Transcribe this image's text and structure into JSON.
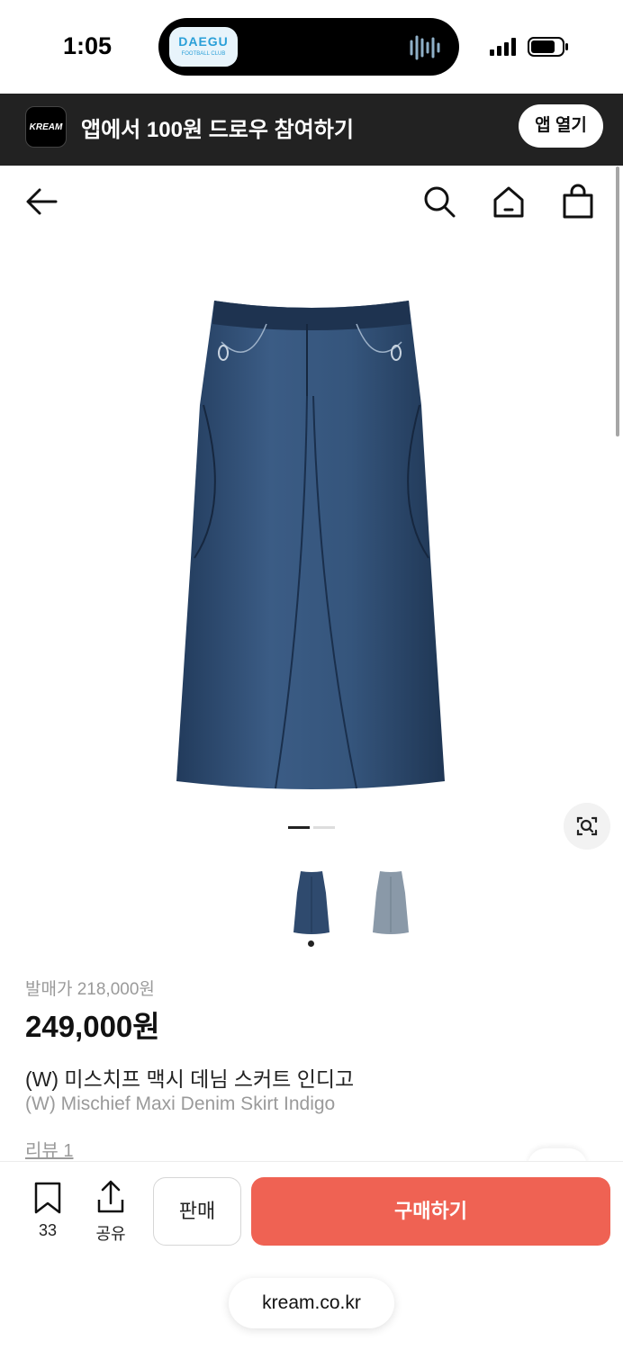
{
  "status_bar": {
    "time": "1:05",
    "island_app_title": "DAEGU",
    "island_app_subtitle": "FOOTBALL CLUB"
  },
  "app_banner": {
    "logo_text": "KREAM",
    "text": "앱에서 100원 드로우 참여하기",
    "open_button_label": "앱 열기"
  },
  "nav": {
    "icons": [
      "back-arrow-icon",
      "search-icon",
      "home-icon",
      "shopping-bag-icon"
    ]
  },
  "product": {
    "original_price": "발매가 218,000원",
    "price": "249,000원",
    "name_ko": "(W) 미스치프 맥시 데님 스커트 인디고",
    "name_en": "(W) Mischief Maxi Denim Skirt Indigo",
    "review_link": "리뷰 1",
    "colors": {
      "indigo": "#2f4a6e",
      "light_blue": "#8a99a8"
    }
  },
  "action_bar": {
    "bookmark_count": "33",
    "share_label": "공유",
    "sell_label": "판매",
    "buy_label": "구매하기",
    "buy_color": "#ef6253"
  },
  "browser": {
    "url": "kream.co.kr"
  }
}
